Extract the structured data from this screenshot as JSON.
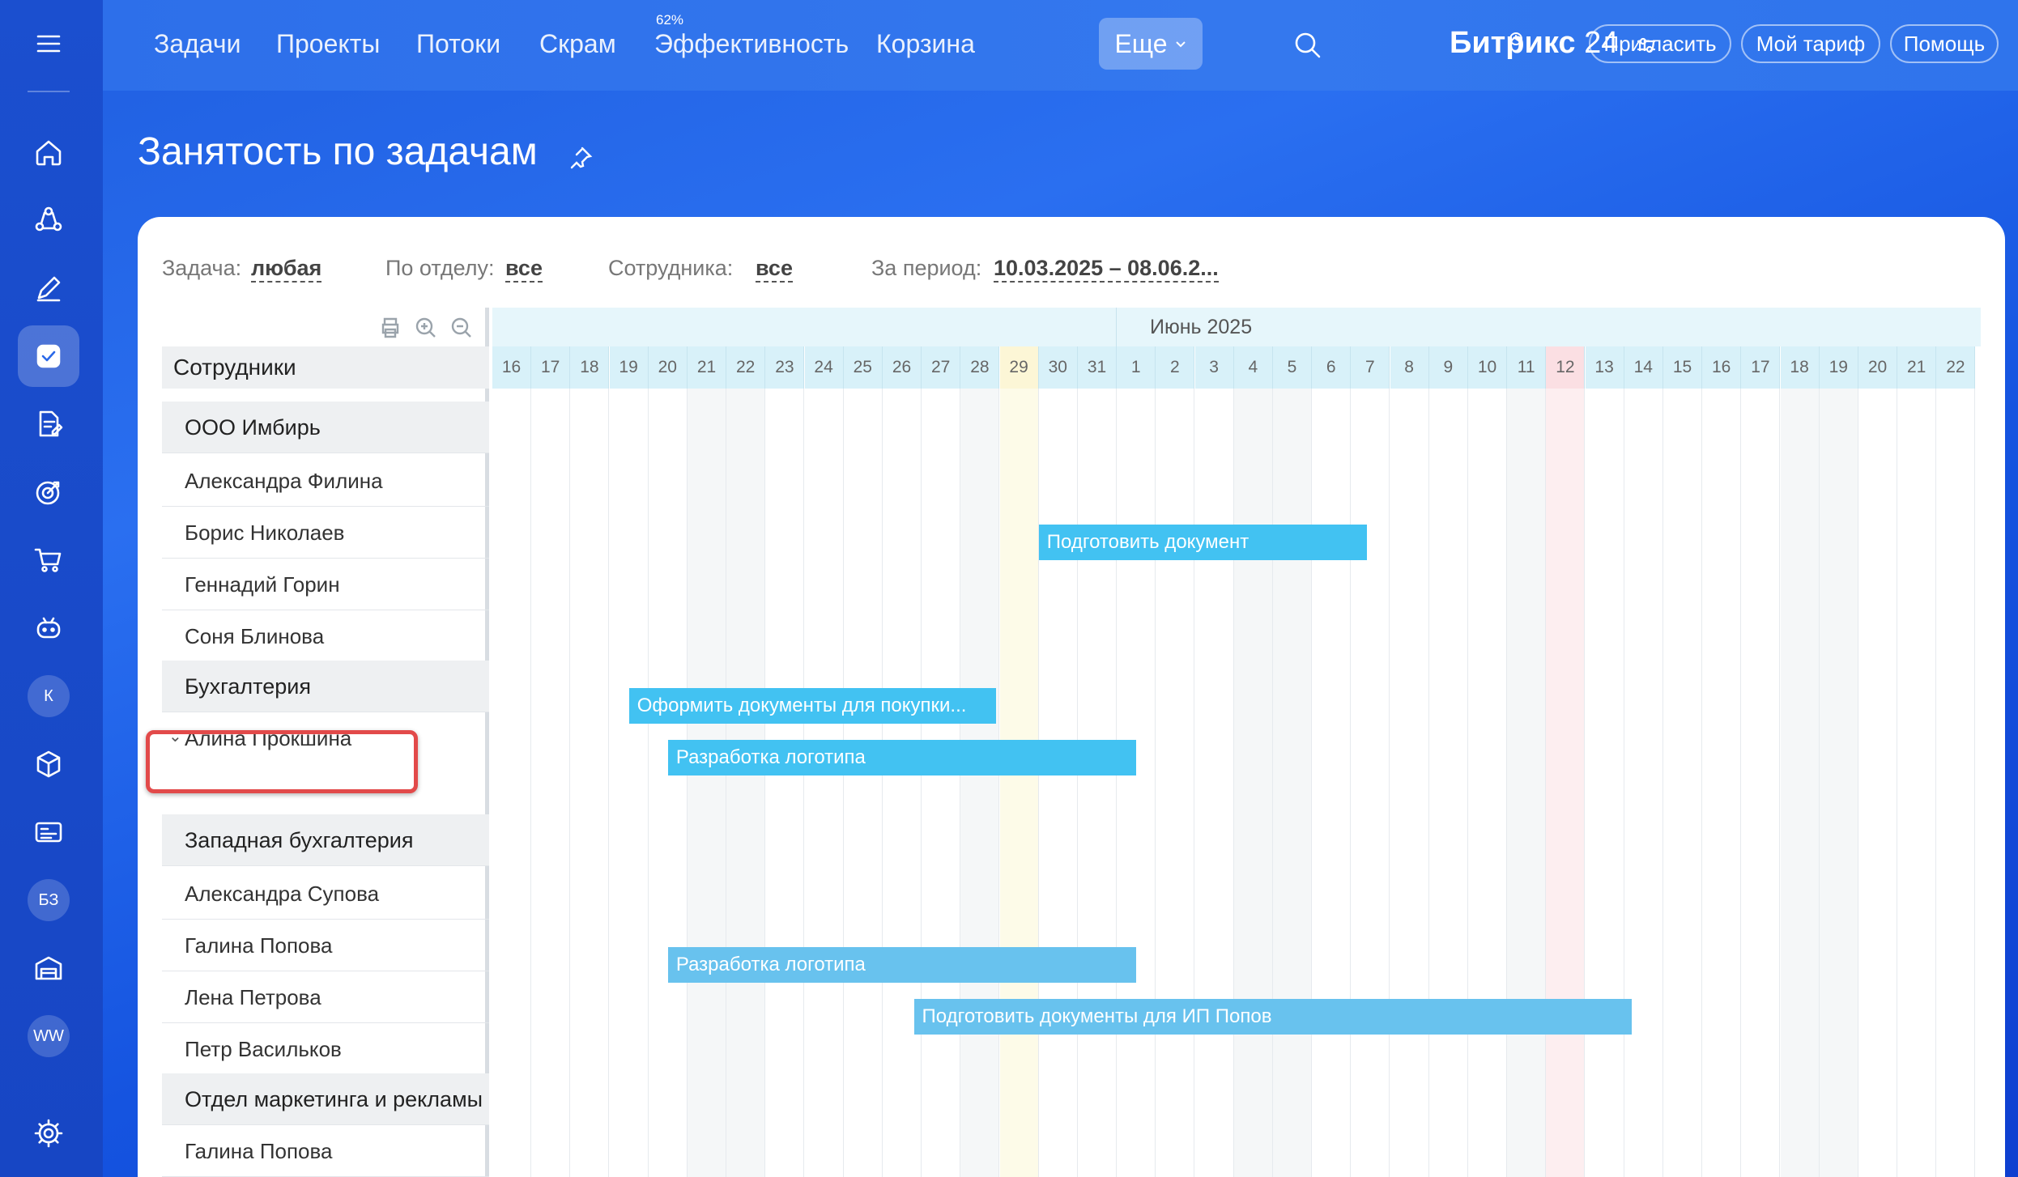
{
  "nav": {
    "items": [
      "Задачи",
      "Проекты",
      "Потоки",
      "Скрам",
      "Эффективность",
      "Корзина"
    ],
    "efficiency_badge": "62%",
    "more_label": "Еще"
  },
  "brand": {
    "name": "Битрикс",
    "num": "24"
  },
  "header_buttons": {
    "invite": "Пригласить",
    "tariff": "Мой тариф",
    "help": "Помощь"
  },
  "sidebar": {
    "avatar_k": "К",
    "avatar_bz": "БЗ",
    "avatar_ww": "WW"
  },
  "page": {
    "title": "Занятость по задачам"
  },
  "filters": {
    "task_label": "Задача:",
    "task_value": "любая",
    "dept_label": "По отделу:",
    "dept_value": "все",
    "emp_label": "Сотрудника:",
    "emp_value": "все",
    "period_label": "За период:",
    "period_value": "10.03.2025 – 08.06.2..."
  },
  "employees": {
    "header": "Сотрудники",
    "rows": [
      {
        "name": "ООО Имбирь",
        "group": true
      },
      {
        "name": "Александра Филина"
      },
      {
        "name": "Борис Николаев"
      },
      {
        "name": "Геннадий Горин"
      },
      {
        "name": "Соня Блинова"
      },
      {
        "name": "Бухгалтерия",
        "group": true
      },
      {
        "name": "Алина Прокшина"
      },
      {
        "name": "Западная бухгалтерия",
        "group": true
      },
      {
        "name": "Александра Супова"
      },
      {
        "name": "Галина Попова"
      },
      {
        "name": "Лена Петрова"
      },
      {
        "name": "Петр Васильков"
      },
      {
        "name": "Отдел маркетинга и рекламы",
        "group": true
      },
      {
        "name": "Галина Попова"
      }
    ]
  },
  "timeline": {
    "month": "Июнь 2025",
    "days": [
      "16",
      "17",
      "18",
      "19",
      "20",
      "21",
      "22",
      "23",
      "24",
      "25",
      "26",
      "27",
      "28",
      "29",
      "30",
      "31",
      "1",
      "2",
      "3",
      "4",
      "5",
      "6",
      "7",
      "8",
      "9",
      "10",
      "11",
      "12",
      "13",
      "14",
      "15",
      "16",
      "17",
      "18",
      "19",
      "20",
      "21",
      "22"
    ],
    "today_index": 13,
    "holiday_index": 27
  },
  "tasks": [
    {
      "title": "Подготовить документ",
      "start": 14,
      "span": 8.4
    },
    {
      "title": "Оформить документы для покупки...",
      "start": 3.5,
      "span": 9.4
    },
    {
      "title": "Разработка логотипа",
      "start": 4.5,
      "span": 12
    },
    {
      "title": "Разработка логотипа",
      "start": 4.5,
      "span": 12
    },
    {
      "title": "Подготовить документы для ИП Попов",
      "start": 10.8,
      "span": 18.4
    }
  ]
}
